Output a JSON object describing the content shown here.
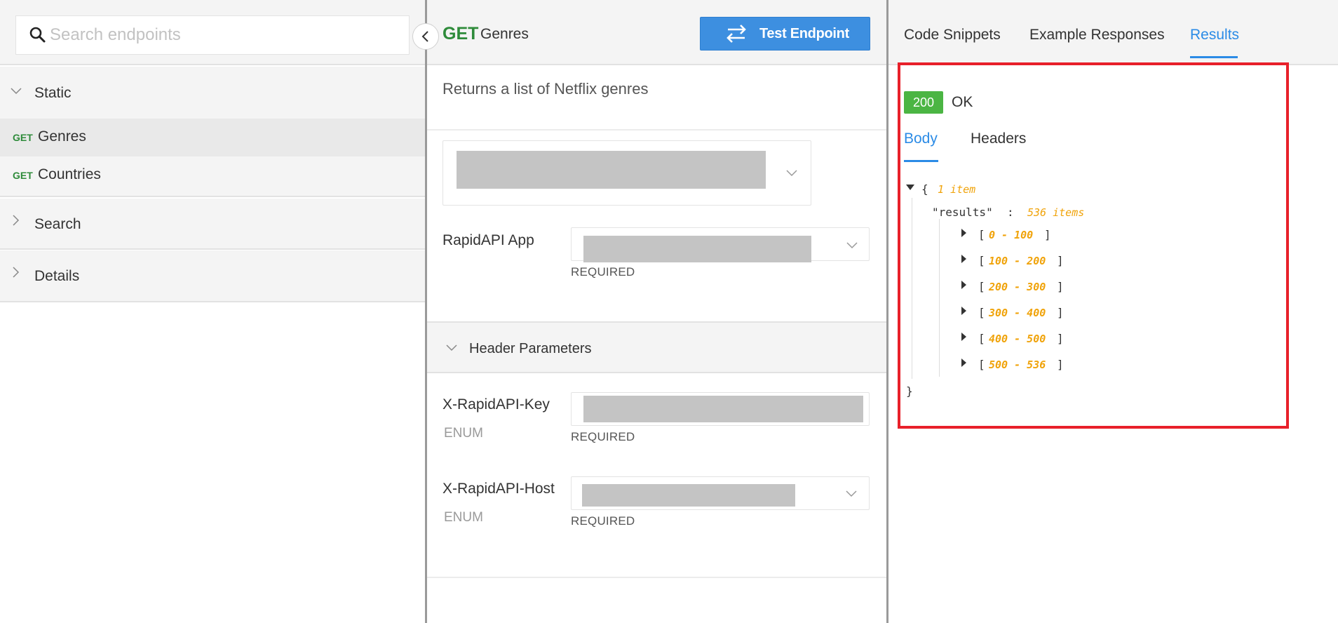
{
  "sidebar": {
    "search_placeholder": "Search endpoints",
    "groups": [
      {
        "label": "Static",
        "expanded": true,
        "endpoints": [
          {
            "method": "GET",
            "name": "Genres",
            "active": true
          },
          {
            "method": "GET",
            "name": "Countries",
            "active": false
          }
        ]
      },
      {
        "label": "Search",
        "expanded": false
      },
      {
        "label": "Details",
        "expanded": false
      }
    ]
  },
  "endpoint": {
    "method": "GET",
    "name": "Genres",
    "test_button_label": "Test Endpoint",
    "description": "Returns a list of Netflix genres",
    "fields": {
      "app_label": "RapidAPI App",
      "app_required": "REQUIRED",
      "header_section_label": "Header Parameters",
      "key_label": "X-RapidAPI-Key",
      "key_type": "ENUM",
      "key_required": "REQUIRED",
      "host_label": "X-RapidAPI-Host",
      "host_type": "ENUM",
      "host_required": "REQUIRED"
    }
  },
  "results": {
    "tabs": [
      "Code Snippets",
      "Example Responses",
      "Results"
    ],
    "active_tab": "Results",
    "status_code": "200",
    "status_text": "OK",
    "subtabs": [
      "Body",
      "Headers"
    ],
    "active_subtab": "Body",
    "json": {
      "open_brace": "{",
      "close_brace": "}",
      "root_meta": "1 item",
      "key": "\"results\"",
      "colon": ":",
      "key_meta": "536 items",
      "ranges": [
        "0 - 100",
        "100 - 200",
        "200 - 300",
        "300 - 400",
        "400 - 500",
        "500 - 536"
      ],
      "bracket_open": "[",
      "bracket_close": "]"
    }
  },
  "colors": {
    "get_method": "#2e8b3a",
    "accent_blue": "#2b8be6",
    "test_button": "#3d8fe0",
    "status_ok": "#4bb543",
    "highlight_border": "#e8202a",
    "json_meta": "#f0a30a"
  },
  "icons": {
    "search": "search-icon",
    "collapse": "chevron-left-icon",
    "test": "swap-arrows-icon",
    "group_expanded": "chevron-down-icon",
    "group_collapsed": "chevron-right-icon"
  }
}
